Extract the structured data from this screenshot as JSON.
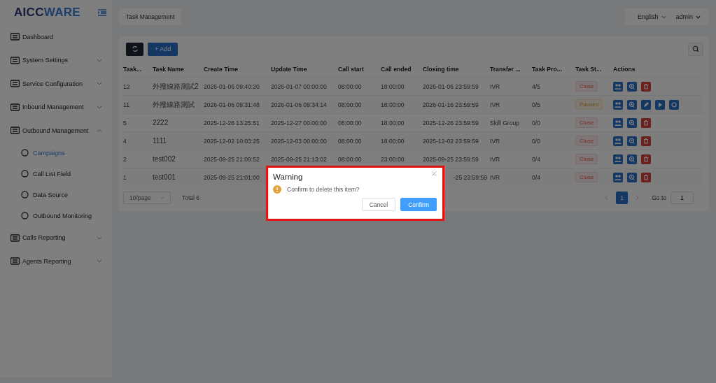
{
  "logo": {
    "part_1": "AICC",
    "part_2": "WARE"
  },
  "sidebar": {
    "items": [
      {
        "label": "Dashboard",
        "kind": "link"
      },
      {
        "label": "System Settings",
        "kind": "group",
        "expanded": false
      },
      {
        "label": "Service Configuration",
        "kind": "group",
        "expanded": false
      },
      {
        "label": "Inbound Management",
        "kind": "group",
        "expanded": false
      },
      {
        "label": "Outbound Management",
        "kind": "group",
        "expanded": true,
        "children": [
          {
            "label": "Campaigns",
            "selected": true
          },
          {
            "label": "Call List Field",
            "selected": false
          },
          {
            "label": "Data Source",
            "selected": false
          },
          {
            "label": "Outbound Monitoring",
            "selected": false
          }
        ]
      },
      {
        "label": "Calls Reporting",
        "kind": "group",
        "expanded": false
      },
      {
        "label": "Agents Reporting",
        "kind": "group",
        "expanded": false
      }
    ]
  },
  "tabs": [
    {
      "label": "Task Management",
      "selected": true
    }
  ],
  "header": {
    "language": "English",
    "user": "admin"
  },
  "toolbar": {
    "add_button": "+ Add"
  },
  "table": {
    "columns": [
      "Task...",
      "Task Name",
      "Create Time",
      "Update Time",
      "Call start",
      "Call ended",
      "Closing time",
      "Transfer ...",
      "Task Pro...",
      "Task St...",
      "Actions"
    ],
    "rows": [
      {
        "id": "12",
        "name": "外撥線路測試2",
        "create_time": "2026-01-06 09:40:20",
        "update_time": "2026-01-07 00:00:00",
        "call_start": "08:00:00",
        "call_ended": "18:00:00",
        "closing_time": "2026-01-06 23:59:59",
        "transfer": "IVR",
        "progress": "4/5",
        "status": {
          "label": "Close",
          "kind": "close"
        },
        "actions": [
          {
            "kind": "users"
          },
          {
            "kind": "zoom"
          },
          {
            "kind": "delete"
          }
        ]
      },
      {
        "id": "11",
        "name": "外撥線路測試",
        "create_time": "2026-01-06 09:31:48",
        "update_time": "2026-01-06 09:34:14",
        "call_start": "08:00:00",
        "call_ended": "18:00:00",
        "closing_time": "2026-01-16 23:59:59",
        "transfer": "IVR",
        "progress": "0/5",
        "status": {
          "label": "Paused",
          "kind": "paused"
        },
        "actions": [
          {
            "kind": "users"
          },
          {
            "kind": "zoom"
          },
          {
            "kind": "edit"
          },
          {
            "kind": "play"
          },
          {
            "kind": "stop"
          }
        ]
      },
      {
        "id": "5",
        "name": "2222",
        "create_time": "2025-12-26 13:25:51",
        "update_time": "2025-12-27 00:00:00",
        "call_start": "08:00:00",
        "call_ended": "18:00:00",
        "closing_time": "2025-12-26 23:59:59",
        "transfer": "Skill Group",
        "progress": "0/0",
        "status": {
          "label": "Close",
          "kind": "close"
        },
        "actions": [
          {
            "kind": "users"
          },
          {
            "kind": "zoom"
          },
          {
            "kind": "delete"
          }
        ]
      },
      {
        "id": "4",
        "name": "1111",
        "create_time": "2025-12-02 10:03:25",
        "update_time": "2025-12-03 00:00:00",
        "call_start": "08:00:00",
        "call_ended": "18:00:00",
        "closing_time": "2025-12-02 23:59:59",
        "transfer": "IVR",
        "progress": "0/0",
        "status": {
          "label": "Close",
          "kind": "close"
        },
        "actions": [
          {
            "kind": "users"
          },
          {
            "kind": "zoom"
          },
          {
            "kind": "delete"
          }
        ]
      },
      {
        "id": "2",
        "name": "test002",
        "create_time": "2025-09-25 21:09:52",
        "update_time": "2025-09-25 21:13:02",
        "call_start": "08:00:00",
        "call_ended": "23:00:00",
        "closing_time": "2025-09-25 23:59:59",
        "transfer": "IVR",
        "progress": "0/4",
        "status": {
          "label": "Close",
          "kind": "close"
        },
        "actions": [
          {
            "kind": "users"
          },
          {
            "kind": "zoom"
          },
          {
            "kind": "delete"
          }
        ]
      },
      {
        "id": "1",
        "name": "test001",
        "create_time": "2025-09-25 21:01:00",
        "closing_time": "-25 23:59:59",
        "covered": true,
        "transfer": "IVR",
        "progress": "0/4",
        "status": {
          "label": "Close",
          "kind": "close"
        },
        "actions": [
          {
            "kind": "users"
          },
          {
            "kind": "zoom"
          },
          {
            "kind": "delete"
          }
        ]
      }
    ]
  },
  "pagination": {
    "page_size": "10/page",
    "total": "Total 6",
    "pages": [
      {
        "label": "1",
        "selected": true
      }
    ],
    "goto_label": "Go to",
    "goto_value": "1"
  },
  "dialog": {
    "title": "Warning",
    "message": "Confirm to delete this item?",
    "buttons": [
      {
        "label": "Cancel",
        "kind": "default"
      },
      {
        "label": "Confirm",
        "kind": "primary"
      }
    ]
  }
}
